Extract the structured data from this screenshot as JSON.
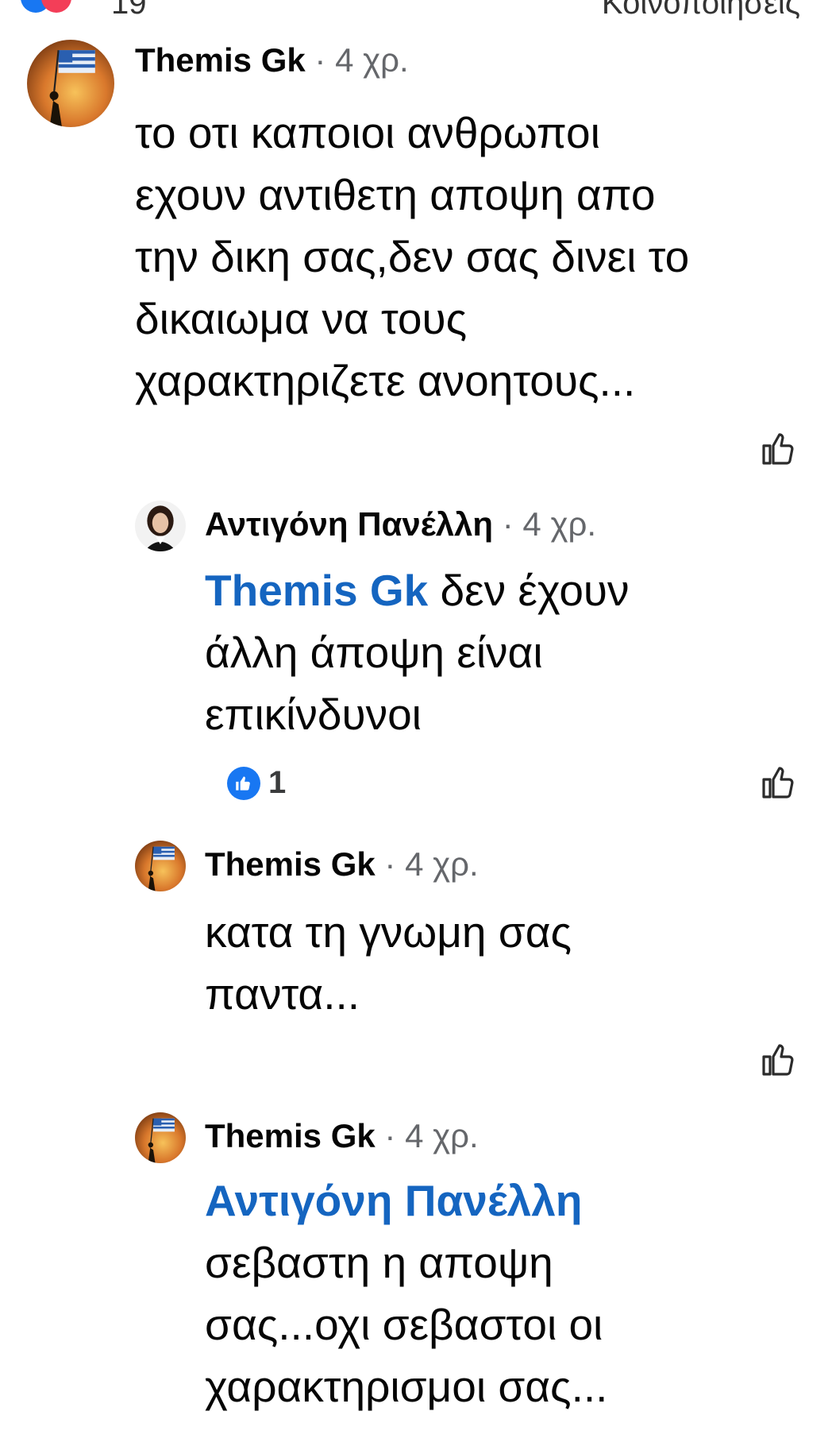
{
  "header": {
    "reaction_count": "19",
    "comments_label": "Κοινοποιήσεις"
  },
  "comments": [
    {
      "author": "Themis Gk",
      "time": "4 χρ.",
      "lines": [
        "το οτι καποιοι ανθρωποι",
        "εχουν αντιθετη αποψη απο",
        "την δικη σας,δεν σας δινει το",
        "δικαιωμα να τους",
        "χαρακτηριζετε ανοητους..."
      ]
    },
    {
      "author": "Αντιγόνη Πανέλλη",
      "time": "4 χρ.",
      "mention": "Themis Gk",
      "lines": [
        " δεν έχουν",
        "άλλη άποψη είναι",
        "επικίνδυνοι"
      ],
      "reaction_count": "1"
    },
    {
      "author": "Themis Gk",
      "time": "4 χρ.",
      "lines": [
        "κατα τη γνωμη σας",
        "παντα..."
      ]
    },
    {
      "author": "Themis Gk",
      "time": "4 χρ.",
      "mention": "Αντιγόνη Πανέλλη",
      "lines": [
        "σεβαστη η αποψη",
        "σας...οχι σεβαστοι οι",
        "χαρακτηρισμοι σας..."
      ]
    }
  ],
  "separator": "·",
  "icons": {
    "like": "thumbs-up-icon",
    "reaction": "like-reaction-icon"
  },
  "colors": {
    "mention": "#1565c0",
    "reaction": "#1877f2",
    "meta": "#65676b"
  }
}
